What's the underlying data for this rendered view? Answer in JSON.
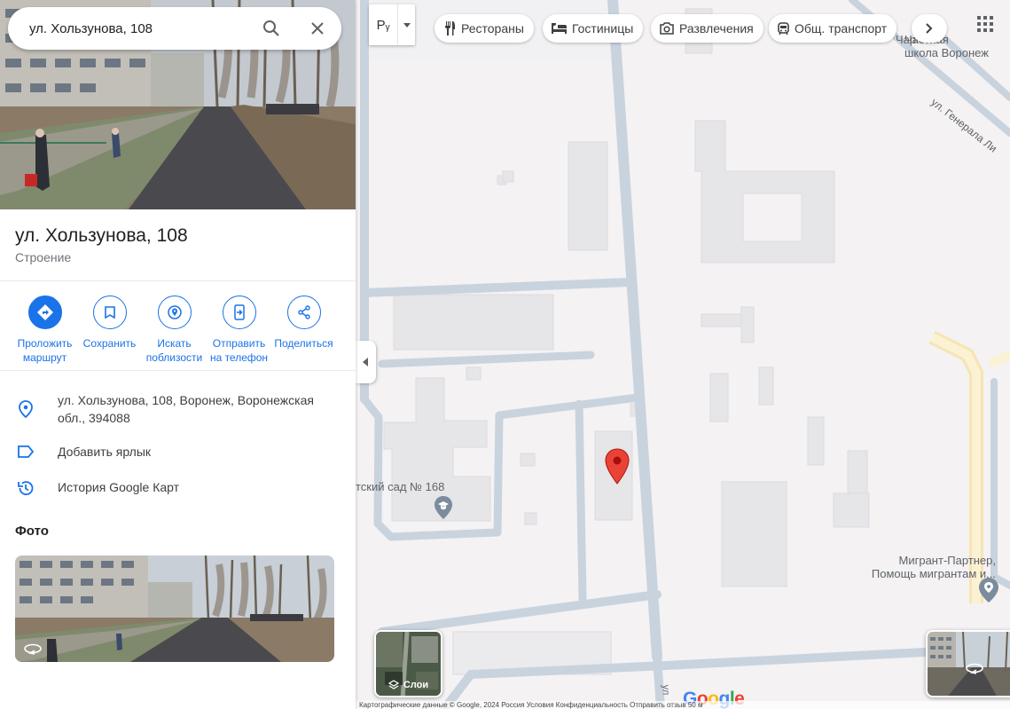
{
  "search": {
    "value": "ул. Хользунова, 108"
  },
  "place": {
    "title": "ул. Хользунова, 108",
    "category": "Строение"
  },
  "actions": [
    {
      "label": "Проложить\nмаршрут",
      "icon": "directions-icon"
    },
    {
      "label": "Сохранить",
      "icon": "bookmark-icon"
    },
    {
      "label": "Искать\nпоблизости",
      "icon": "nearby-icon"
    },
    {
      "label": "Отправить\nна телефон",
      "icon": "send-to-phone-icon"
    },
    {
      "label": "Поделиться",
      "icon": "share-icon"
    }
  ],
  "info": {
    "address": "ул. Хользунова, 108, Воронеж, Воронежская обл., 394088",
    "add_label": "Добавить ярлык",
    "history": "История Google Карт"
  },
  "photos": {
    "heading": "Фото"
  },
  "map": {
    "language_button": "Рᵧ",
    "chips": [
      {
        "label": "Рестораны",
        "icon": "restaurant-icon"
      },
      {
        "label": "Гостиницы",
        "icon": "hotel-icon"
      },
      {
        "label": "Развлечения",
        "icon": "camera-icon"
      },
      {
        "label": "Общ. транспорт",
        "icon": "transit-icon"
      }
    ],
    "labels": {
      "school": "Частная\nшкола Воронеж",
      "school_prefix": "Чар",
      "street": "ул. Генерала Ли",
      "kindergarten": "тский сад № 168",
      "migrant": "Мигрант-Партнер,\nПомощь мигрантам и...",
      "street_bottom": "ул"
    },
    "layers_label": "Слои",
    "google": "Google",
    "copyright": "Картографические данные © Google, 2024   Россия   Условия   Конфиденциальность   Отправить отзыв   50 м"
  },
  "colors": {
    "accent": "#1a73e8",
    "pin": "#ea4335",
    "road": "#c8d3df",
    "building": "#e6e5e8"
  }
}
